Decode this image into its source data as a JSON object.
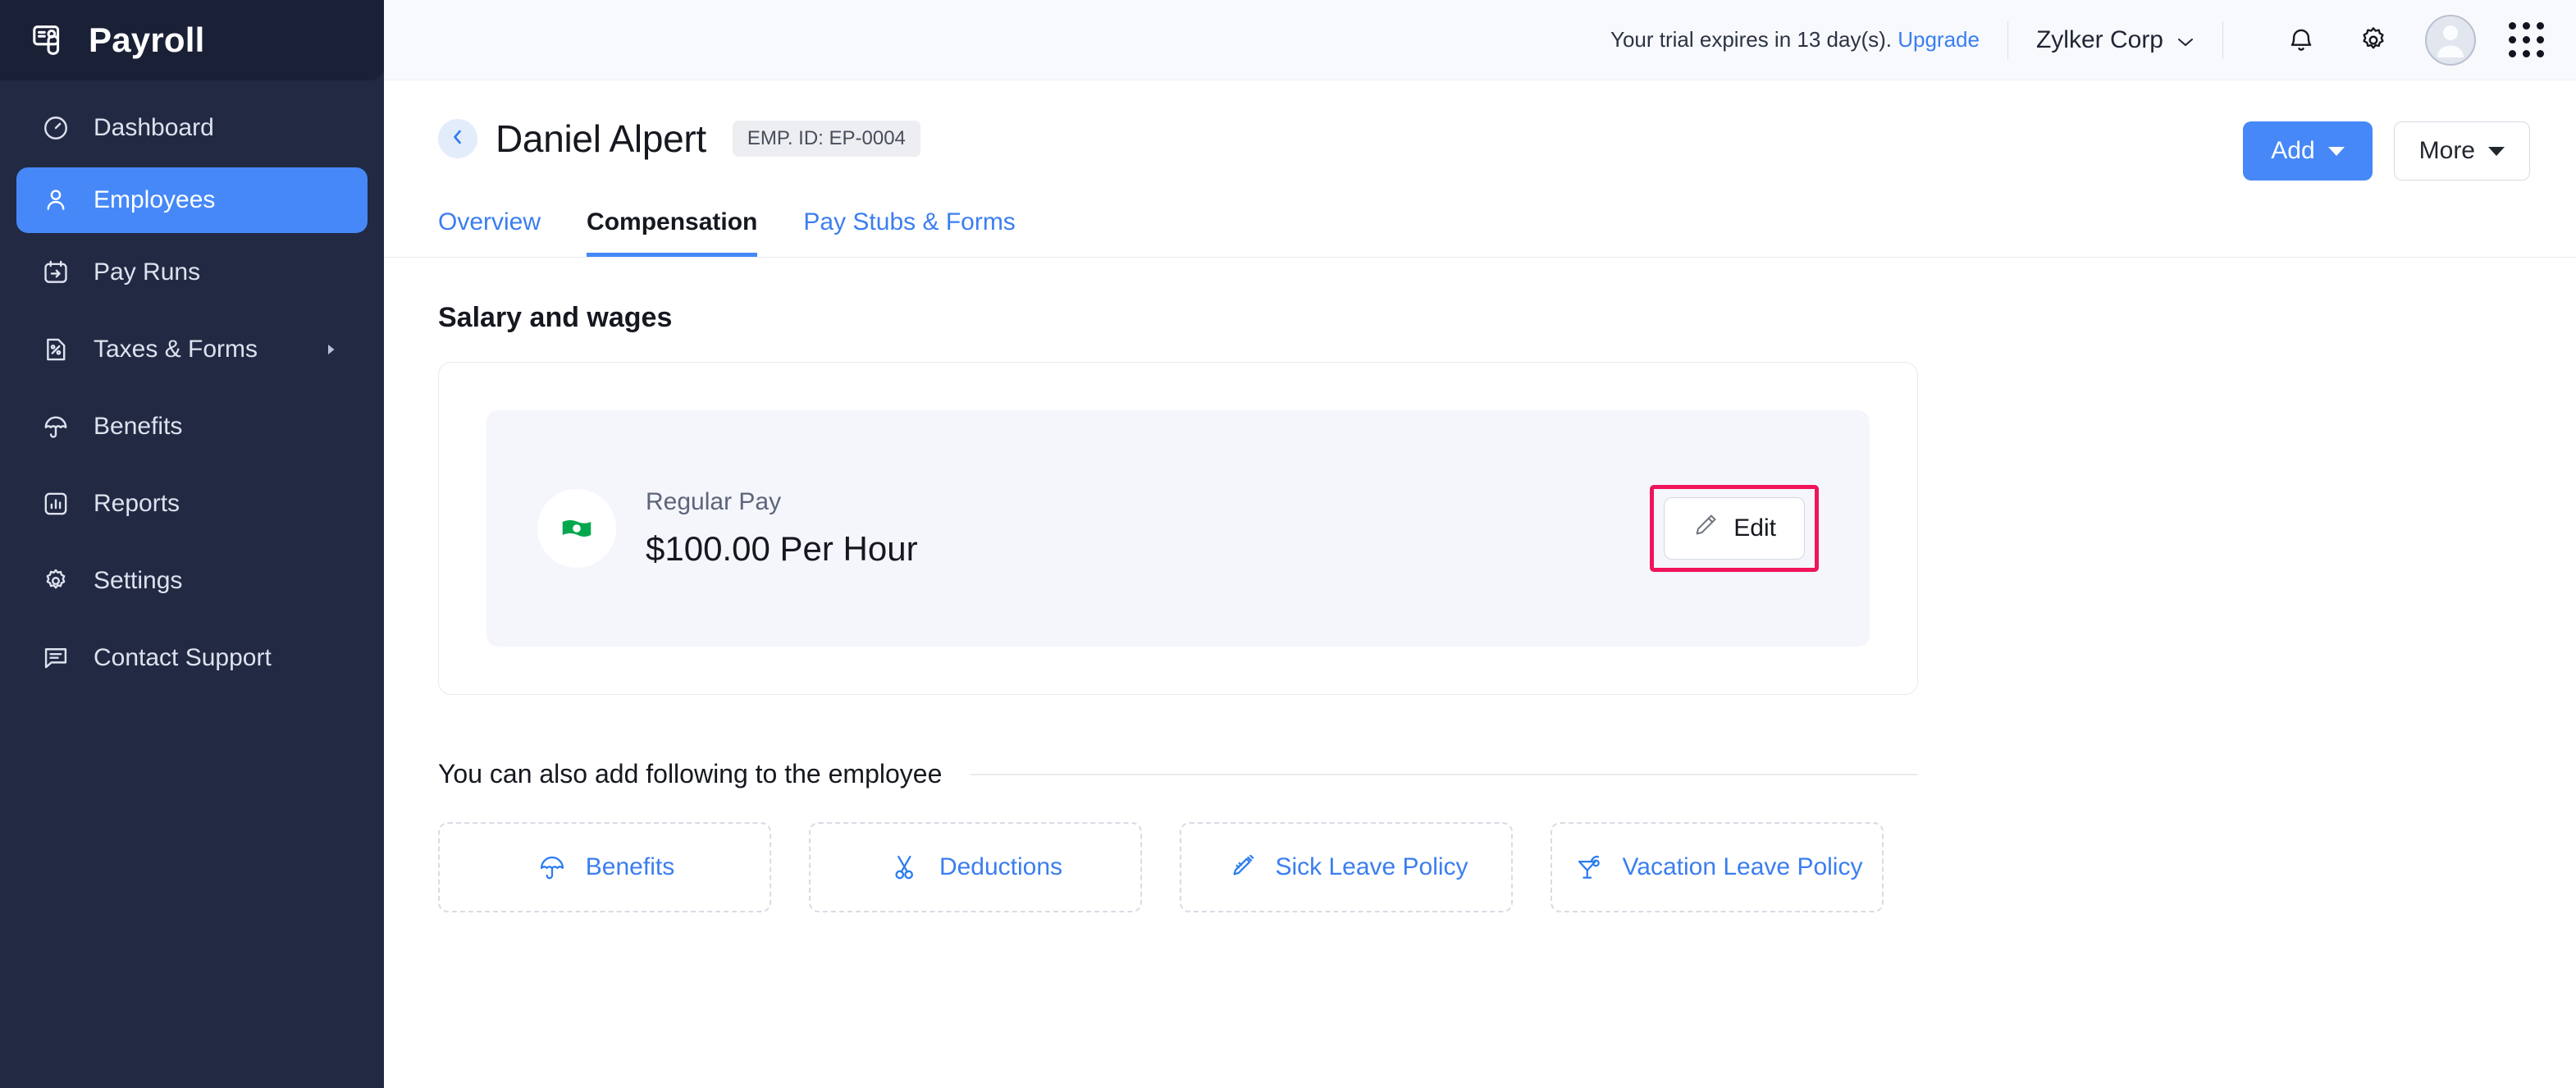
{
  "sidebar": {
    "brand": "Payroll",
    "brand_icon": "payroll-card-icon",
    "items": [
      {
        "label": "Dashboard",
        "icon": "clock-dashboard-icon",
        "active": false,
        "has_submenu": false
      },
      {
        "label": "Employees",
        "icon": "person-icon",
        "active": true,
        "has_submenu": false
      },
      {
        "label": "Pay Runs",
        "icon": "calendar-arrow-icon",
        "active": false,
        "has_submenu": false
      },
      {
        "label": "Taxes & Forms",
        "icon": "document-percent-icon",
        "active": false,
        "has_submenu": true
      },
      {
        "label": "Benefits",
        "icon": "umbrella-icon",
        "active": false,
        "has_submenu": false
      },
      {
        "label": "Reports",
        "icon": "bar-chart-icon",
        "active": false,
        "has_submenu": false
      },
      {
        "label": "Settings",
        "icon": "gear-icon",
        "active": false,
        "has_submenu": false
      },
      {
        "label": "Contact Support",
        "icon": "chat-bubble-icon",
        "active": false,
        "has_submenu": false
      }
    ],
    "active_bg": "#4688f7",
    "bg": "#222943"
  },
  "topbar": {
    "trial_text": "Your trial expires in 13 day(s).",
    "upgrade_label": "Upgrade",
    "org_name": "Zylker Corp",
    "icons": [
      "bell-icon",
      "gear-icon",
      "avatar",
      "apps-grid-icon"
    ]
  },
  "page": {
    "back_icon": "chevron-left-icon",
    "employee_name": "Daniel Alpert",
    "employee_id_badge": "EMP. ID: EP-0004",
    "add_button": "Add",
    "more_button": "More"
  },
  "tabs": [
    {
      "label": "Overview",
      "active": false
    },
    {
      "label": "Compensation",
      "active": true
    },
    {
      "label": "Pay Stubs & Forms",
      "active": false
    }
  ],
  "salary": {
    "section_title": "Salary and wages",
    "pay_icon": "money-bill-icon",
    "pay_label": "Regular Pay",
    "pay_value": "$100.00 Per Hour",
    "edit_label": "Edit",
    "edit_icon": "pencil-icon",
    "highlight_color": "#f0145a"
  },
  "also_add": {
    "title": "You can also add following to the employee",
    "tiles": [
      {
        "label": "Benefits",
        "icon": "umbrella-icon"
      },
      {
        "label": "Deductions",
        "icon": "scissors-icon"
      },
      {
        "label": "Sick Leave Policy",
        "icon": "syringe-icon"
      },
      {
        "label": "Vacation Leave Policy",
        "icon": "cocktail-icon"
      }
    ]
  },
  "colors": {
    "accent": "#4688f7",
    "link": "#3b7ef0",
    "sidebar": "#222943",
    "topbar_bg": "#f7f9fd",
    "panel_bg": "#f4f6fc",
    "money_green": "#03a84e"
  }
}
